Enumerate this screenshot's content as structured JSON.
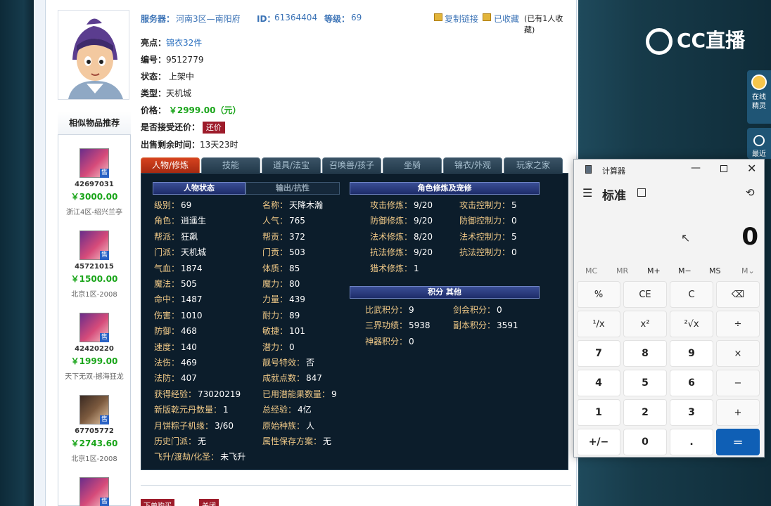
{
  "server": {
    "label": "服务器：",
    "value": "河南3区—南阳府",
    "id_label": "ID：",
    "id_value": "61364404",
    "level_label": "等级：",
    "level_value": "69",
    "copy_link": "复制链接",
    "collected": "已收藏",
    "collect_count": "(已有1人收藏)"
  },
  "info": {
    "highlight_label": "亮点：",
    "highlight_value": "锦衣32件",
    "number_label": "编号：",
    "number_value": "9512779",
    "status_label": "状态：",
    "status_value": "上架中",
    "type_label": "类型：",
    "type_value": "天机城",
    "price_label": "价格：",
    "price_value": "￥2999.00（元）",
    "bargain_label": "是否接受还价：",
    "bargain_button": "还价",
    "remaining_label": "出售剩余时间：",
    "remaining_value": "13天23时"
  },
  "sidebar": {
    "title": "相似物品推荐",
    "items": [
      {
        "id": "42697031",
        "price": "￥3000.00",
        "server": "浙江4区-绍兴兰亭",
        "tag": "售"
      },
      {
        "id": "45721015",
        "price": "￥1500.00",
        "server": "北京1区-2008",
        "tag": "售"
      },
      {
        "id": "42420220",
        "price": "￥1999.00",
        "server": "天下无双-撼海狂龙",
        "tag": "售"
      },
      {
        "id": "67705772",
        "price": "￥2743.60",
        "server": "北京1区-2008",
        "tag": "售"
      },
      {
        "id": "",
        "price": "",
        "server": "",
        "tag": "售"
      }
    ]
  },
  "tabs": [
    "人物/修炼",
    "技能",
    "道具/法宝",
    "召唤兽/孩子",
    "坐骑",
    "锦衣/外观",
    "玩家之家"
  ],
  "panel": {
    "hdr_status": "人物状态",
    "hdr_output": "输出/抗性",
    "hdr_cultivation": "角色修炼及宠修",
    "hdr_points": "积分 其他",
    "left_col": [
      {
        "k": "级别：",
        "v": "69"
      },
      {
        "k": "角色：",
        "v": "逍遥生"
      },
      {
        "k": "帮派：",
        "v": "狂飙"
      },
      {
        "k": "门派：",
        "v": "天机城"
      },
      {
        "k": "气血：",
        "v": "1874"
      },
      {
        "k": "魔法：",
        "v": "505"
      },
      {
        "k": "命中：",
        "v": "1487"
      },
      {
        "k": "伤害：",
        "v": "1010"
      },
      {
        "k": "防御：",
        "v": "468"
      },
      {
        "k": "速度：",
        "v": "140"
      },
      {
        "k": "法伤：",
        "v": "469"
      },
      {
        "k": "法防：",
        "v": "407"
      },
      {
        "k": "获得经验：",
        "v": "73020219"
      },
      {
        "k": "新版乾元丹数量：",
        "v": "1"
      },
      {
        "k": "月饼粽子机缘：",
        "v": "3/60"
      },
      {
        "k": "历史门派：",
        "v": "无"
      },
      {
        "k": "飞升/渡劫/化圣：",
        "v": "未飞升"
      }
    ],
    "mid_col": [
      {
        "k": "名称：",
        "v": "天降木瀚"
      },
      {
        "k": "人气：",
        "v": "765"
      },
      {
        "k": "帮贡：",
        "v": "372"
      },
      {
        "k": "门贡：",
        "v": "503"
      },
      {
        "k": "体质：",
        "v": "85"
      },
      {
        "k": "魔力：",
        "v": "80"
      },
      {
        "k": "力量：",
        "v": "439"
      },
      {
        "k": "耐力：",
        "v": "89"
      },
      {
        "k": "敏捷：",
        "v": "101"
      },
      {
        "k": "潜力：",
        "v": "0"
      },
      {
        "k": "靓号特效：",
        "v": "否"
      },
      {
        "k": "成就点数：",
        "v": "847"
      },
      {
        "k": "已用潜能果数量：",
        "v": "9"
      },
      {
        "k": "总经验：",
        "v": "4亿"
      },
      {
        "k": "原始种族：",
        "v": "人"
      },
      {
        "k": "属性保存方案：",
        "v": "无"
      }
    ],
    "cult_left": [
      {
        "k": "攻击修炼：",
        "v": "9/20"
      },
      {
        "k": "防御修炼：",
        "v": "9/20"
      },
      {
        "k": "法术修炼：",
        "v": "8/20"
      },
      {
        "k": "抗法修炼：",
        "v": "9/20"
      },
      {
        "k": "猎术修炼：",
        "v": "1"
      }
    ],
    "cult_right": [
      {
        "k": "攻击控制力：",
        "v": "5"
      },
      {
        "k": "防御控制力：",
        "v": "0"
      },
      {
        "k": "法术控制力：",
        "v": "5"
      },
      {
        "k": "抗法控制力：",
        "v": "0"
      }
    ],
    "points_left": [
      {
        "k": "比武积分：",
        "v": "9"
      },
      {
        "k": "三界功绩：",
        "v": "5938"
      },
      {
        "k": "神器积分：",
        "v": "0"
      }
    ],
    "points_right": [
      {
        "k": "剑会积分：",
        "v": "0"
      },
      {
        "k": "副本积分：",
        "v": "3591"
      }
    ]
  },
  "footer": {
    "buy": "下单购买",
    "close": "关闭"
  },
  "overlay": {
    "logo": "CC直播",
    "online_label": "在线\n精灵",
    "widget2": "最近"
  },
  "calculator": {
    "title": "计算器",
    "mode": "标准",
    "display": "0",
    "memory": [
      "MC",
      "MR",
      "M+",
      "M−",
      "MS",
      "M⌄"
    ],
    "keys": [
      "%",
      "CE",
      "C",
      "⌫",
      "¹/x",
      "x²",
      "²√x",
      "÷",
      "7",
      "8",
      "9",
      "×",
      "4",
      "5",
      "6",
      "−",
      "1",
      "2",
      "3",
      "+",
      "+/−",
      "0",
      ".",
      "="
    ]
  }
}
